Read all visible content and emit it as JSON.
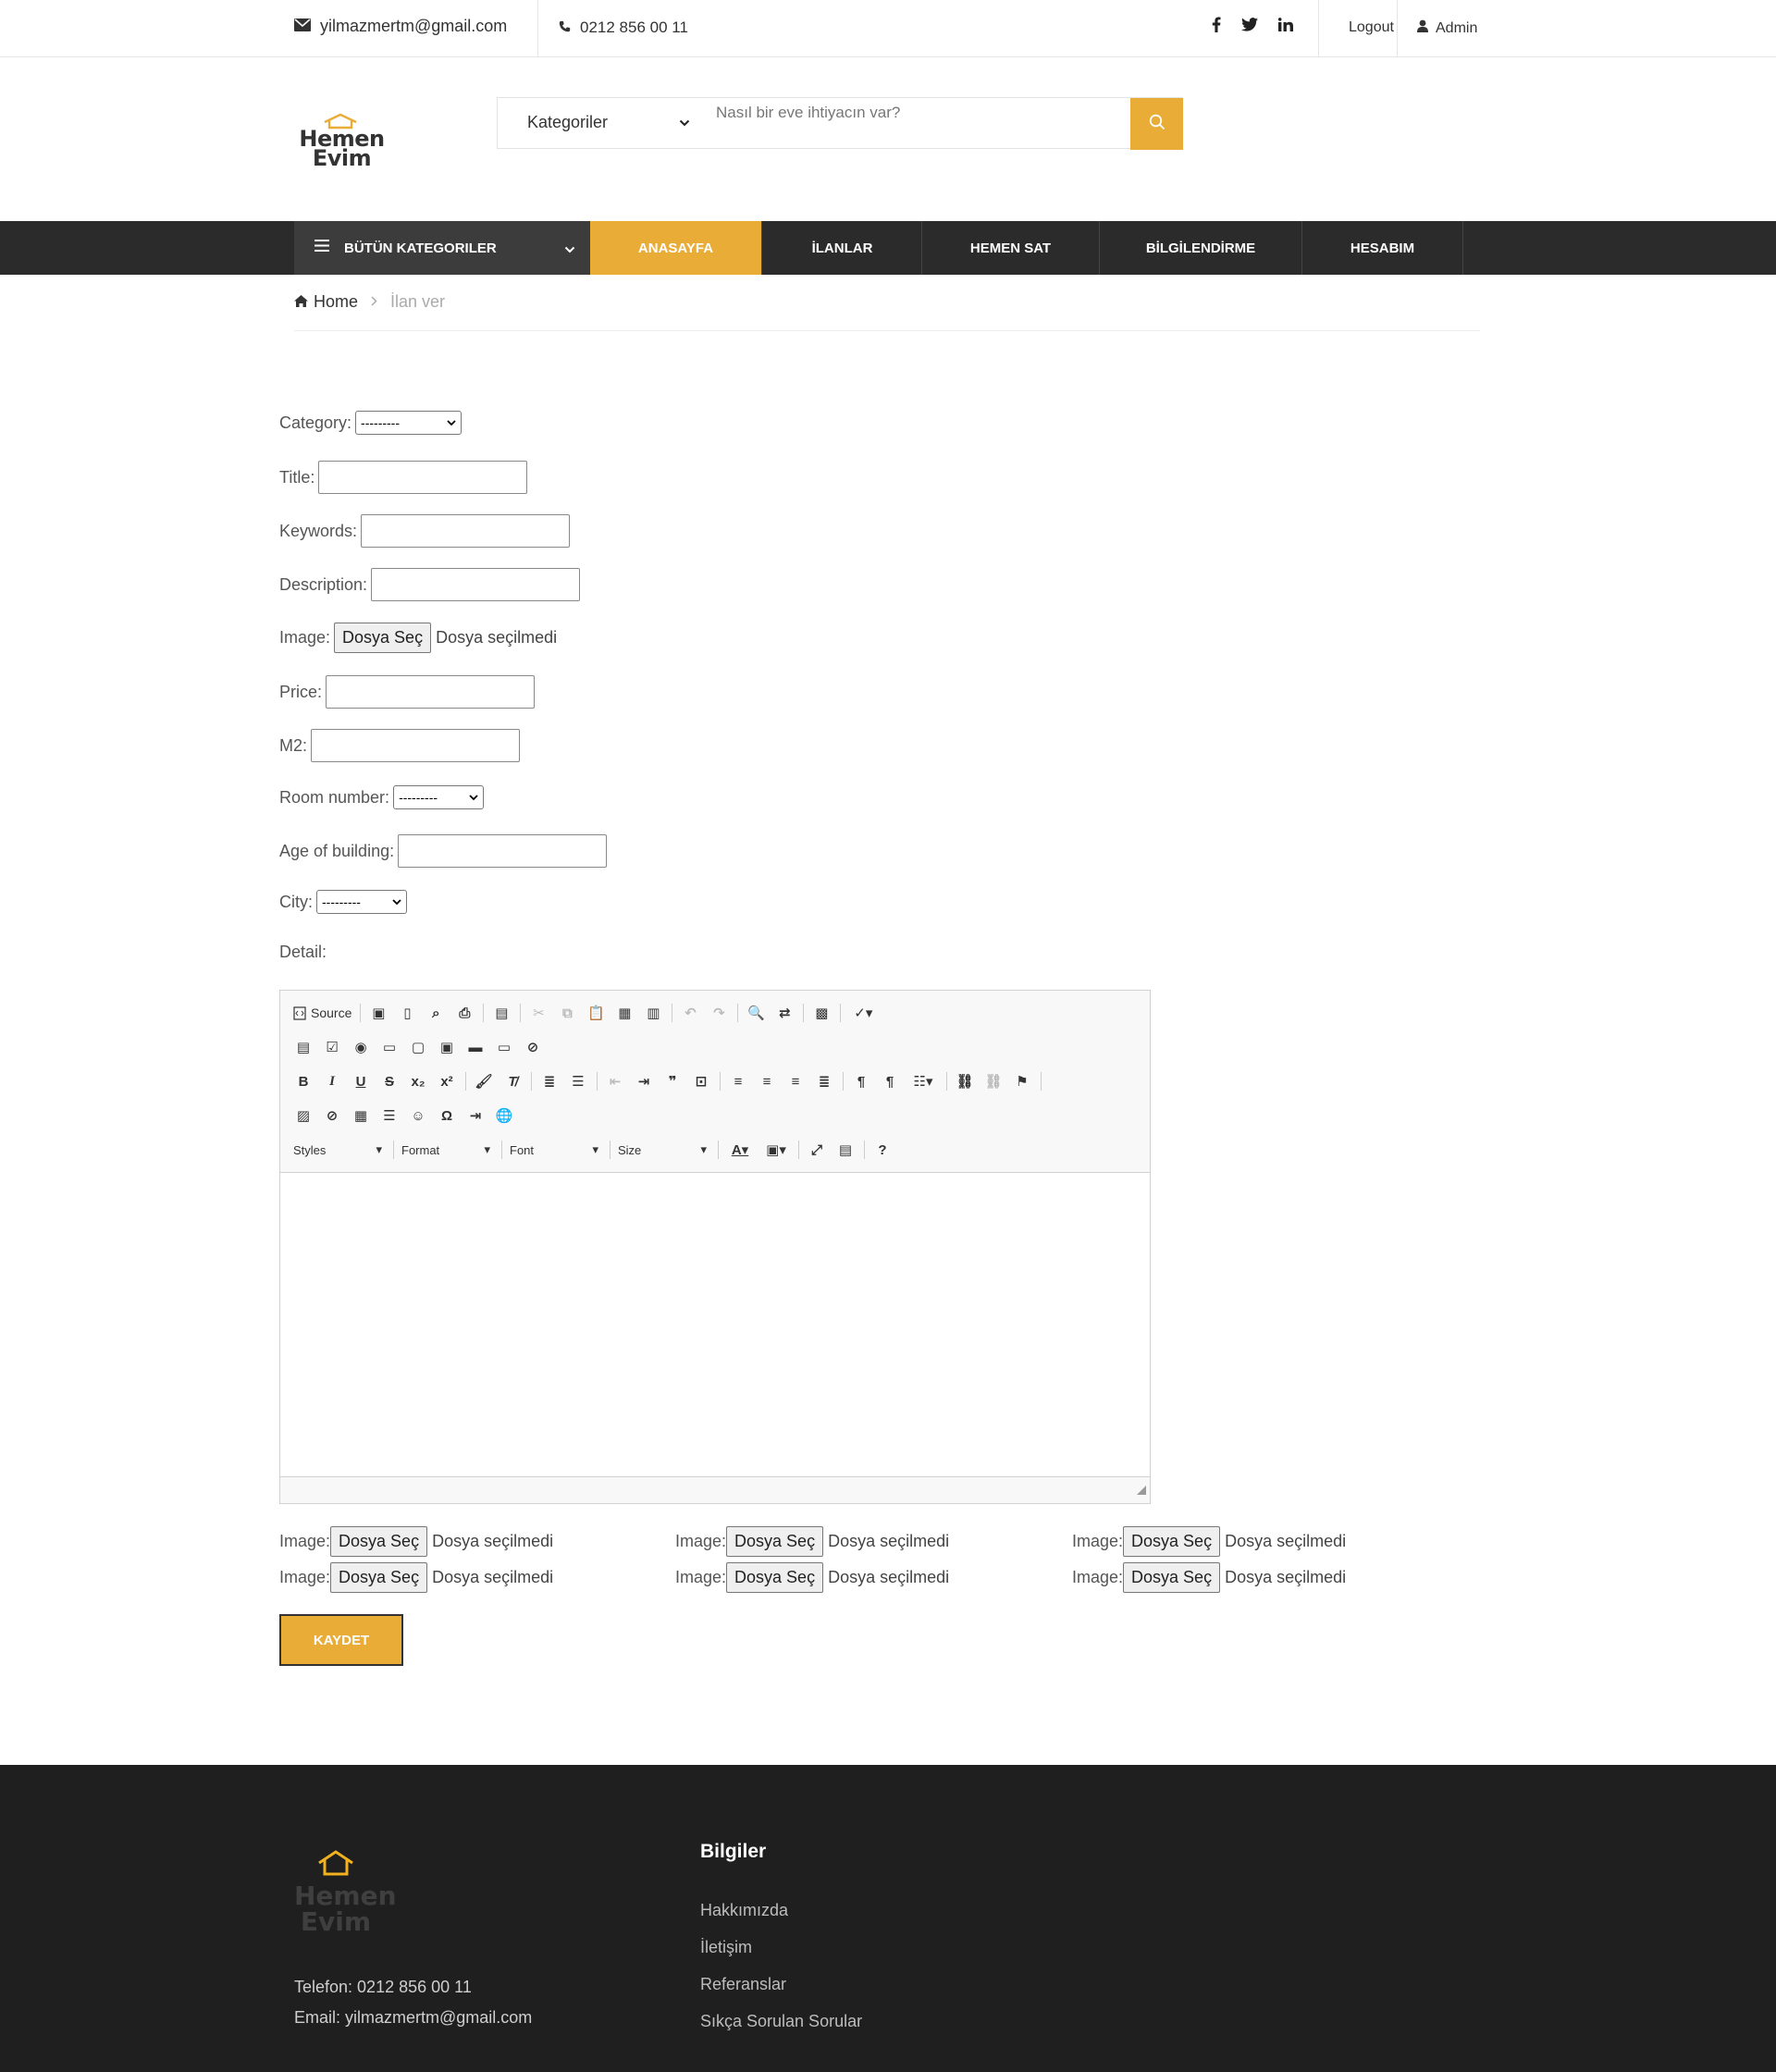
{
  "topbar": {
    "email": "yilmazmertm@gmail.com",
    "phone": "0212 856 00 11",
    "logout": "Logout",
    "admin": "Admin"
  },
  "header": {
    "logo_text_1": "Hemen",
    "logo_text_2": "Evim",
    "category_select": "Kategoriler",
    "search_placeholder": "Nasıl bir eve ihtiyacın var?"
  },
  "nav": {
    "all_categories": "BÜTÜN KATEGORILER",
    "items": [
      "ANASAYFA",
      "İLANLAR",
      "HEMEN SAT",
      "BİLGİLENDİRME",
      "HESABIM"
    ]
  },
  "breadcrumb": {
    "home": "Home",
    "current": "İlan ver"
  },
  "form": {
    "category_label": "Category:",
    "category_value": "---------",
    "title_label": "Title:",
    "keywords_label": "Keywords:",
    "description_label": "Description:",
    "image_label": "Image:",
    "file_button": "Dosya Seç",
    "no_file": "Dosya seçilmedi",
    "price_label": "Price:",
    "m2_label": "M2:",
    "room_label": "Room number:",
    "room_value": "---------",
    "age_label": "Age of building:",
    "city_label": "City:",
    "city_value": "---------",
    "detail_label": "Detail:",
    "save_button": "KAYDET"
  },
  "editor": {
    "source": "Source",
    "styles": "Styles",
    "format": "Format",
    "font": "Font",
    "size": "Size"
  },
  "footer": {
    "logo_text_1": "Hemen",
    "logo_text_2": "Evim",
    "phone": "Telefon: 0212 856 00 11",
    "email": "Email: yilmazmertm@gmail.com",
    "heading": "Bilgiler",
    "links": [
      "Hakkımızda",
      "İletişim",
      "Referanslar",
      "Sıkça Sorulan Sorular"
    ]
  },
  "colors": {
    "accent": "#e9ac36",
    "nav_bg": "#2b2b2b",
    "footer_bg": "#1f1f1f"
  }
}
